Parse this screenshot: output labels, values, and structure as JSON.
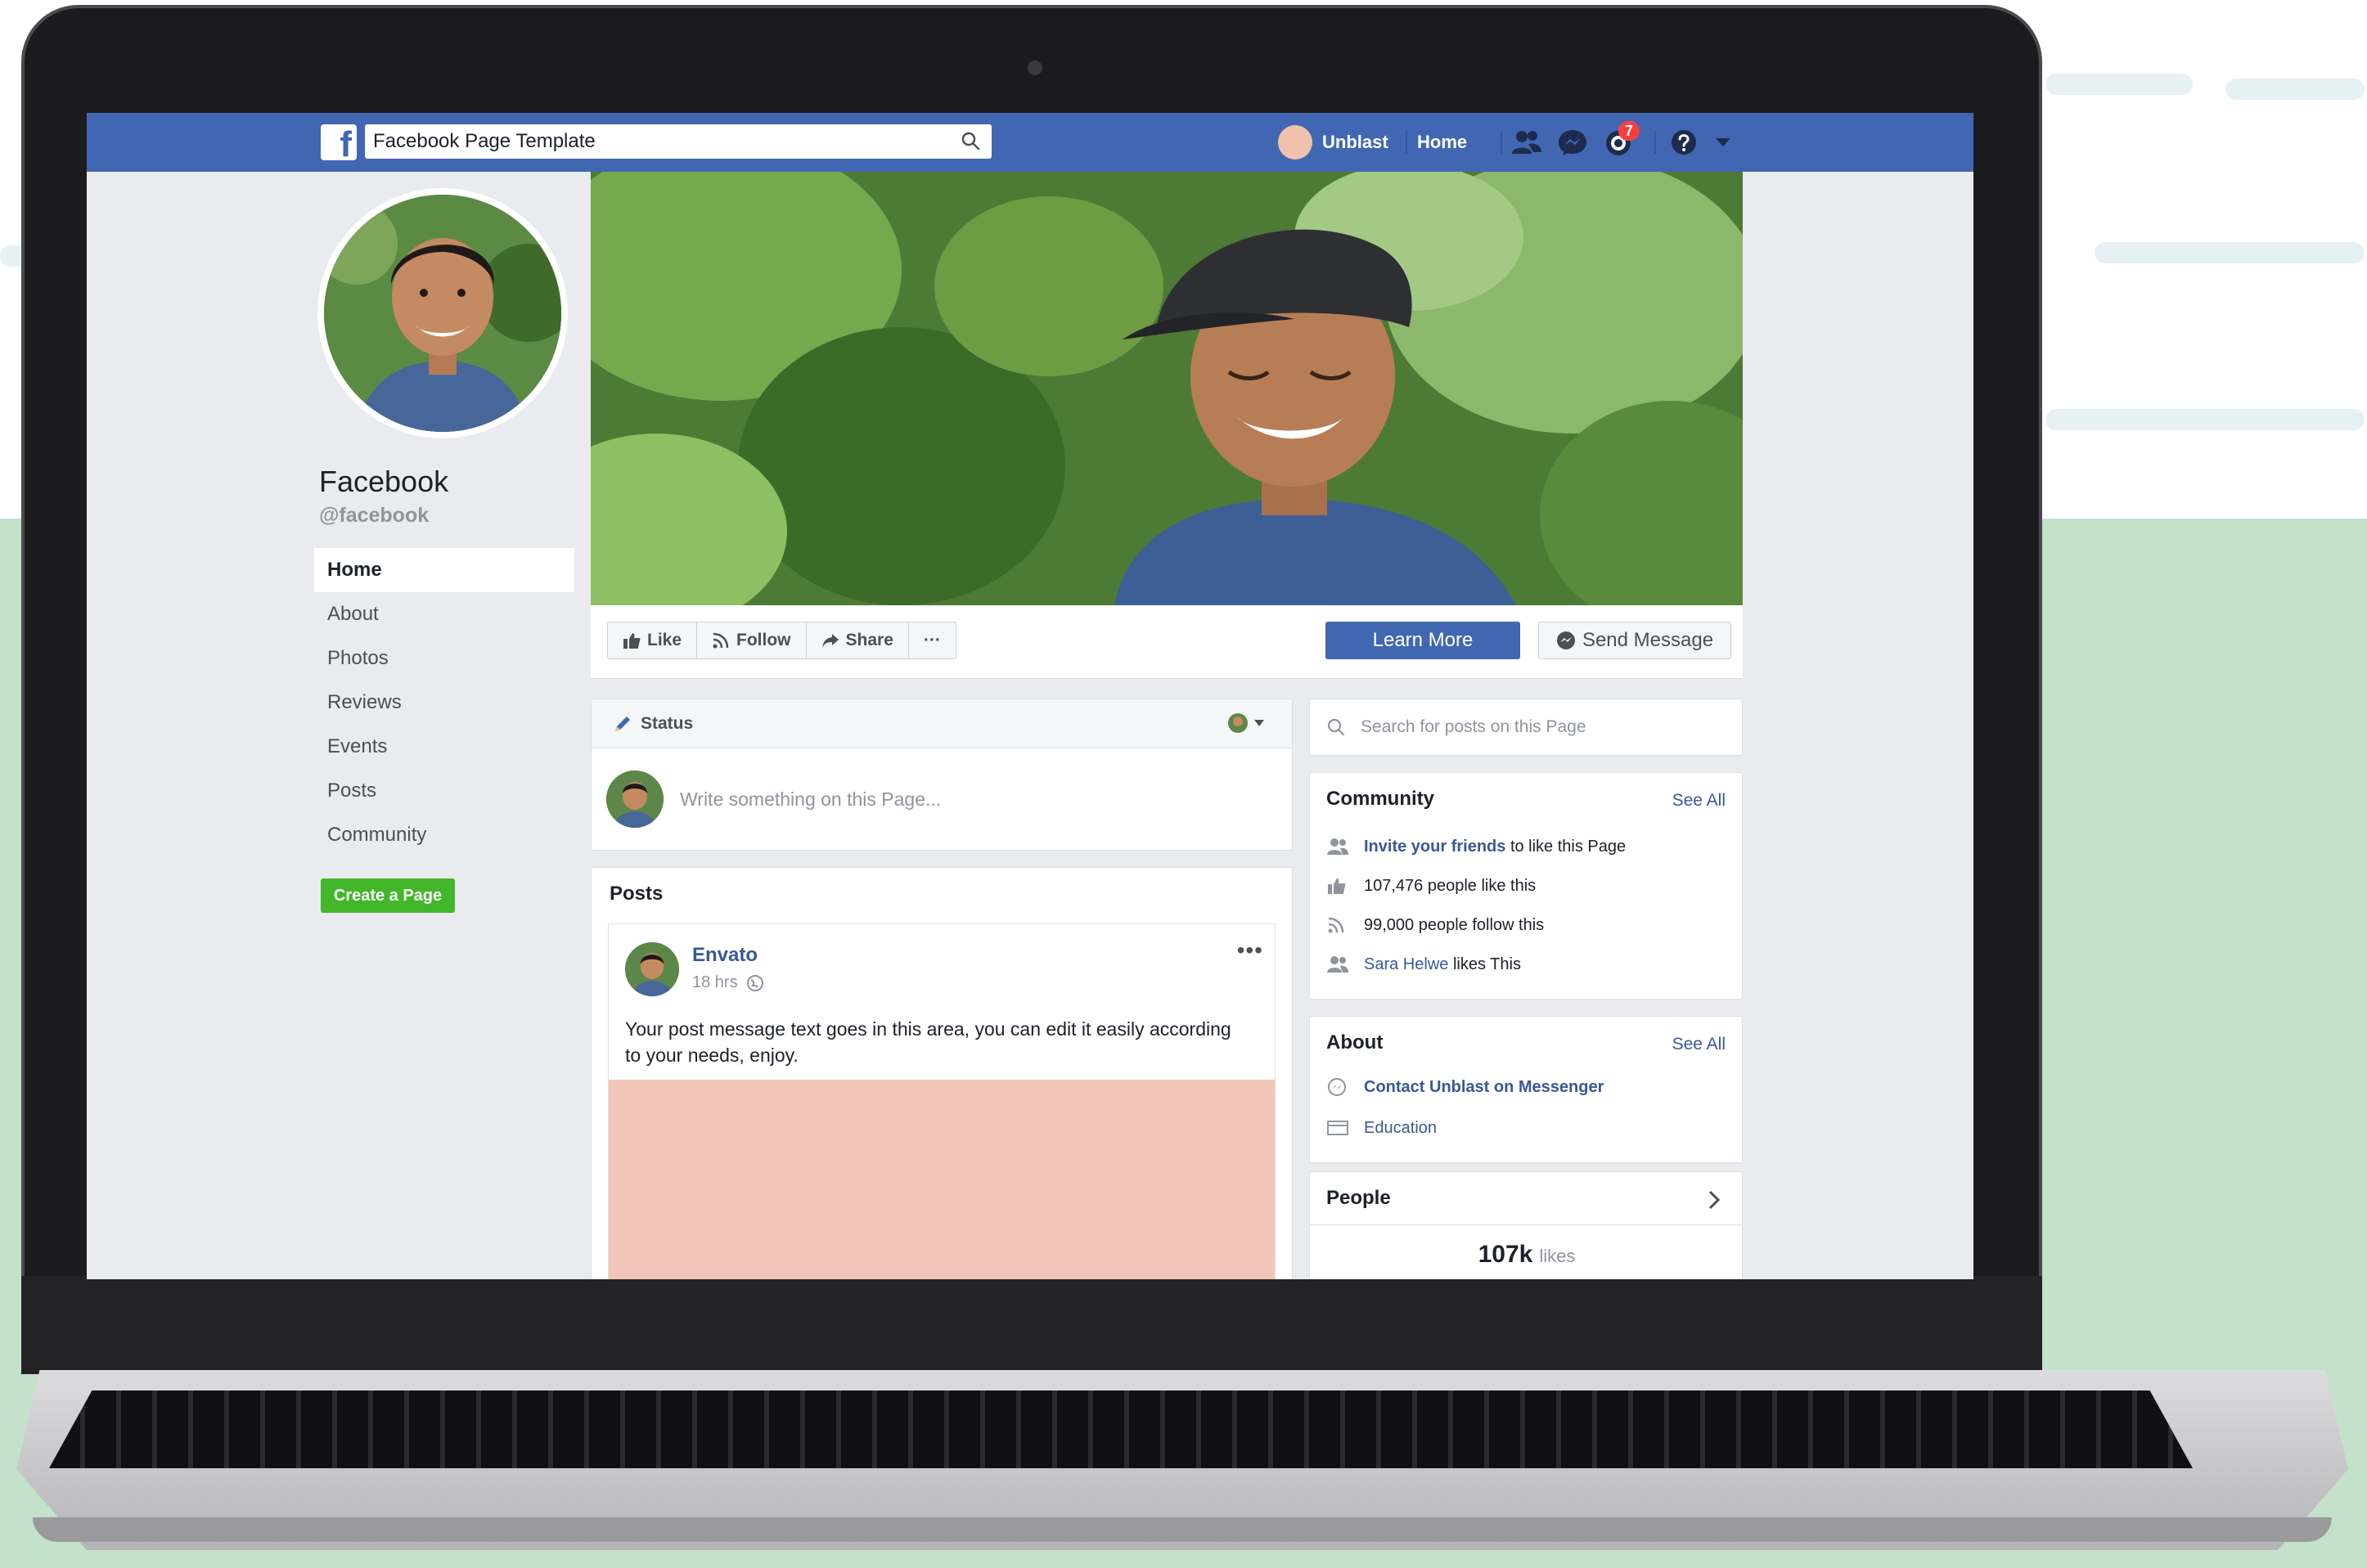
{
  "browser": {
    "search_value": "Facebook Page Template"
  },
  "topbar": {
    "user_name": "Unblast",
    "home_label": "Home",
    "notification_count": "7"
  },
  "profile": {
    "name": "Facebook",
    "handle": "@facebook"
  },
  "sidebar": {
    "items": [
      {
        "label": "Home"
      },
      {
        "label": "About"
      },
      {
        "label": "Photos"
      },
      {
        "label": "Reviews"
      },
      {
        "label": "Events"
      },
      {
        "label": "Posts"
      },
      {
        "label": "Community"
      }
    ],
    "create_page_label": "Create a Page"
  },
  "actions": {
    "like_label": "Like",
    "follow_label": "Follow",
    "share_label": "Share",
    "more_label": "···",
    "learn_more_label": "Learn More",
    "send_message_label": "Send Message"
  },
  "composer": {
    "tab_label": "Status",
    "placeholder": "Write something on this Page..."
  },
  "posts": {
    "title": "Posts",
    "items": [
      {
        "author": "Envato",
        "time": "18 hrs",
        "text": "Your post message text goes in this area, you can edit it easily according to your needs, enjoy.",
        "more": "•••"
      }
    ]
  },
  "right": {
    "search_placeholder": "Search for posts on this Page",
    "community": {
      "title": "Community",
      "see_all": "See All",
      "invite_link": "Invite your friends",
      "invite_rest": "to like this Page",
      "likes_text": "107,476 people like this",
      "follows_text": "99,000 people follow this",
      "friend_name": "Sara Helwe",
      "friend_rest": "likes This"
    },
    "about": {
      "title": "About",
      "see_all": "See All",
      "messenger_link": "Contact Unblast on Messenger",
      "education_link": "Education"
    },
    "people": {
      "title": "People",
      "likes_value": "107k",
      "likes_unit": "likes"
    }
  },
  "colors": {
    "brand_blue": "#4267b2",
    "link_blue": "#385898",
    "create_green": "#42b72a",
    "badge_red": "#fa3e3e",
    "post_image": "#f1c6b8",
    "page_bg": "#e9ebee",
    "backdrop_green": "#c4e2c9"
  }
}
